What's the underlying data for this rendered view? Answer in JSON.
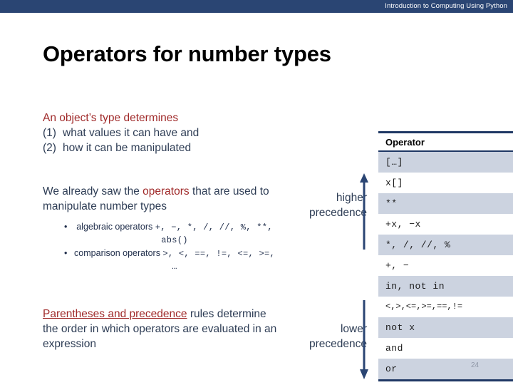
{
  "banner": {
    "title": "Introduction to Computing Using Python",
    "bg_color": "#2a4573"
  },
  "slide": {
    "title": "Operators for number types",
    "page_number": "24"
  },
  "colors": {
    "accent_red": "#a02a2a",
    "body_blue": "#2e3d55",
    "table_border": "#1f3864",
    "table_shade": "#ccd3e0"
  },
  "body": {
    "para_1": {
      "lead": "An object’s type determines",
      "items": [
        {
          "num": "(1)",
          "text": "what values it can have and"
        },
        {
          "num": "(2)",
          "text": "how it can be manipulated"
        }
      ]
    },
    "para_2": {
      "before": "We already saw the ",
      "highlight": "operators",
      "after": " that are used to manipulate number types"
    },
    "bullets": [
      {
        "label": "algebraic operators ",
        "code": "+, −, *, /, //, %, **, abs()"
      },
      {
        "label": "comparison operators ",
        "code": ">, <, ==, !=, <=, >=, …"
      }
    ],
    "para_3": {
      "highlight": "Parentheses and precedence",
      "after": " rules determine the order in which operators are evaluated in an expression"
    }
  },
  "precedence": {
    "higher_line1": "higher",
    "higher_line2": "precedence",
    "lower_line1": "lower",
    "lower_line2": "precedence"
  },
  "operator_table": {
    "header": "Operator",
    "rows": [
      {
        "value": "[…]",
        "shaded": true
      },
      {
        "value": "x[]",
        "shaded": false
      },
      {
        "value": "**",
        "shaded": true
      },
      {
        "value": "+x,  −x",
        "shaded": false
      },
      {
        "value": "*,  /,  //,  %",
        "shaded": true
      },
      {
        "value": "+,  −",
        "shaded": false
      },
      {
        "value": "in, not in",
        "shaded": true
      },
      {
        "value": "<,>,<=,>=,==,!=",
        "shaded": false,
        "tight": true
      },
      {
        "value": "not x",
        "shaded": true
      },
      {
        "value": "and",
        "shaded": false
      },
      {
        "value": "or",
        "shaded": true
      }
    ]
  }
}
